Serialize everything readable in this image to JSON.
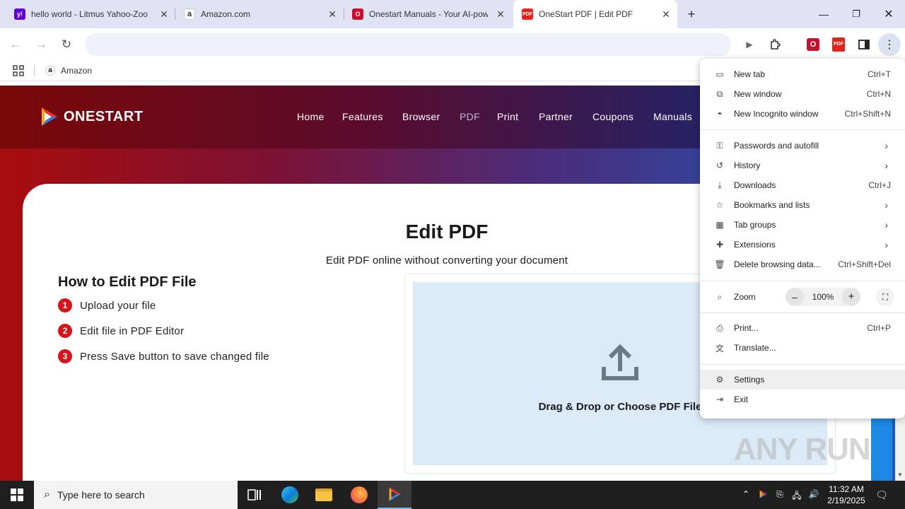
{
  "tabs": [
    {
      "title": "hello world - Litmus Yahoo-Zoo",
      "favicon": "yahoo-icon",
      "color": "#6001d2"
    },
    {
      "title": "Amazon.com",
      "favicon": "amazon-icon",
      "color": "#232f3e"
    },
    {
      "title": "Onestart Manuals - Your AI-powe",
      "favicon": "onestart-manuals-icon",
      "color": "#c8102e"
    },
    {
      "title": "OneStart PDF | Edit PDF",
      "favicon": "pdf-icon",
      "color": "#e1251b"
    }
  ],
  "toolbar": {
    "address_value": "",
    "ext_pdf_label": "PDF"
  },
  "bookmarks": {
    "items": [
      {
        "label": "Amazon"
      }
    ]
  },
  "site": {
    "logo": "ONESTART",
    "nav": [
      "Home",
      "Features",
      "Browser",
      "PDF",
      "Print",
      "Partner",
      "Coupons",
      "Manuals"
    ]
  },
  "main": {
    "title": "Edit PDF",
    "subtitle": "Edit PDF online without converting your document",
    "how_to_title": "How to Edit PDF File",
    "steps": [
      {
        "num": "1",
        "text": "Upload your file"
      },
      {
        "num": "2",
        "text": "Edit file in PDF Editor"
      },
      {
        "num": "3",
        "text": "Press Save button to save changed file"
      }
    ],
    "dropzone_text": "Drag & Drop or Choose PDF File"
  },
  "menu": {
    "items": [
      {
        "label": "New tab",
        "shortcut": "Ctrl+T"
      },
      {
        "label": "New window",
        "shortcut": "Ctrl+N"
      },
      {
        "label": "New Incognito window",
        "shortcut": "Ctrl+Shift+N"
      },
      {
        "label": "Passwords and autofill",
        "shortcut": ""
      },
      {
        "label": "History",
        "shortcut": ""
      },
      {
        "label": "Downloads",
        "shortcut": "Ctrl+J"
      },
      {
        "label": "Bookmarks and lists",
        "shortcut": ""
      },
      {
        "label": "Tab groups",
        "shortcut": ""
      },
      {
        "label": "Extensions",
        "shortcut": ""
      },
      {
        "label": "Delete browsing data...",
        "shortcut": "Ctrl+Shift+Del"
      },
      {
        "label": "Print...",
        "shortcut": "Ctrl+P"
      },
      {
        "label": "Translate...",
        "shortcut": ""
      },
      {
        "label": "Settings",
        "shortcut": ""
      },
      {
        "label": "Exit",
        "shortcut": ""
      }
    ],
    "zoom": {
      "label": "Zoom",
      "value": "100%",
      "minus": "–",
      "plus": "+"
    }
  },
  "watermark": "ANY RUN",
  "taskbar": {
    "search_placeholder": "Type here to search",
    "time": "11:32 AM",
    "date": "2/19/2025"
  },
  "colors": {
    "accent_red": "#d8141b",
    "dropzone_bg": "#dbeaf7",
    "menu_highlight": "#efefef"
  }
}
